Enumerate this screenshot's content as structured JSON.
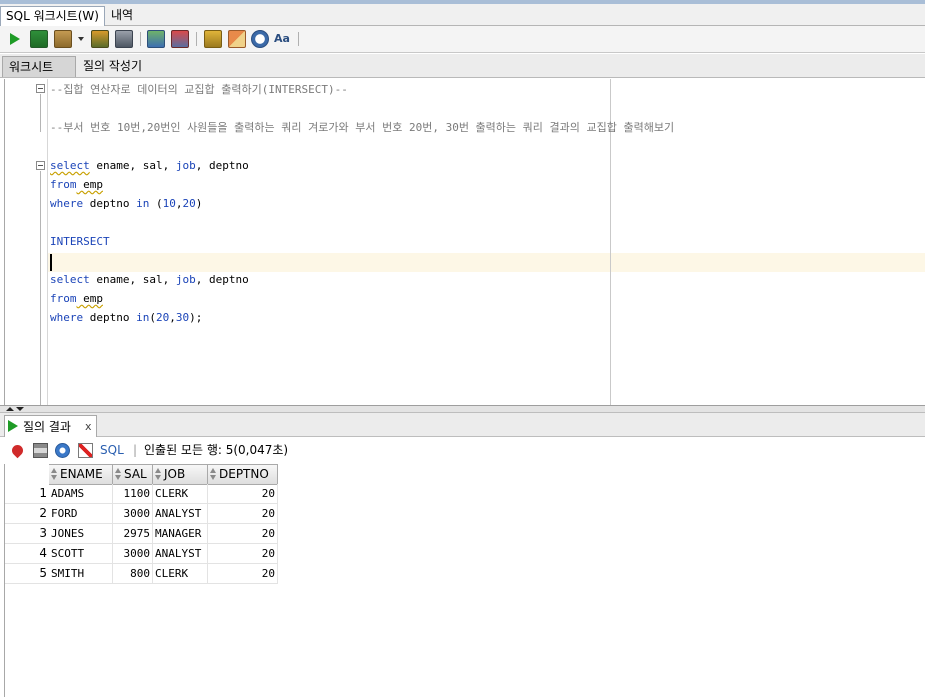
{
  "window": {
    "tabs": [
      {
        "label": "SQL 워크시트(W)"
      },
      {
        "label": "내역"
      }
    ]
  },
  "toolbar": {
    "buttons": [
      {
        "icon": "run-statement-icon"
      },
      {
        "icon": "run-script-icon"
      },
      {
        "icon": "multiple-sessions-icon"
      },
      {
        "icon": "explain-plan-icon"
      },
      {
        "icon": "autotrace-icon"
      },
      {
        "icon": "commit-icon"
      },
      {
        "icon": "rollback-icon"
      },
      {
        "icon": "sql-tuning-icon"
      },
      {
        "icon": "clear-icon"
      },
      {
        "icon": "history-icon"
      },
      {
        "icon": "format-icon"
      }
    ]
  },
  "subtabs": [
    {
      "label": "워크시트"
    },
    {
      "label": "질의 작성기"
    }
  ],
  "editor": {
    "lines": [
      {
        "text": "--집합 연산자로 데이터의 교집합 출력하기(INTERSECT)--"
      },
      {
        "text": ""
      },
      {
        "text": "--부서 번호 10번,20번인 사원들을 출력하는 쿼리 겨로가와 부서 번호 20번, 30번 출력하는 쿼리 결과의 교집합 출력해보기"
      },
      {
        "text": ""
      },
      {
        "kw1": "select",
        "rest1": " ename, sal, ",
        "kw2": "job",
        "rest2": ", deptno"
      },
      {
        "kw1": "from",
        "rest1": " emp"
      },
      {
        "kw1": "where",
        "rest1": " deptno ",
        "kw2": "in",
        "rest2": " (",
        "n1": "10",
        "c": ",",
        "n2": "20",
        "end": ")"
      },
      {
        "text": ""
      },
      {
        "kw1": "INTERSECT"
      },
      {
        "text": ""
      },
      {
        "kw1": "select",
        "rest1": " ename, sal, ",
        "kw2": "job",
        "rest2": ", deptno"
      },
      {
        "kw1": "from",
        "rest1": " emp"
      },
      {
        "kw1": "where",
        "rest1": " deptno ",
        "kw2": "in",
        "rest2": "(",
        "n1": "20",
        "c": ",",
        "n2": "30",
        "end": ");"
      }
    ]
  },
  "results": {
    "tab_label": "질의 결과",
    "tab_close": "x",
    "sql_label": "SQL",
    "separator": "|",
    "status": "인출된 모든 행: 5(0,047초)",
    "columns": [
      "ENAME",
      "SAL",
      "JOB",
      "DEPTNO"
    ],
    "rows": [
      {
        "num": "1",
        "ename": "ADAMS",
        "sal": "1100",
        "job": "CLERK",
        "deptno": "20"
      },
      {
        "num": "2",
        "ename": "FORD",
        "sal": "3000",
        "job": "ANALYST",
        "deptno": "20"
      },
      {
        "num": "3",
        "ename": "JONES",
        "sal": "2975",
        "job": "MANAGER",
        "deptno": "20"
      },
      {
        "num": "4",
        "ename": "SCOTT",
        "sal": "3000",
        "job": "ANALYST",
        "deptno": "20"
      },
      {
        "num": "5",
        "ename": "SMITH",
        "sal": "800",
        "job": "CLERK",
        "deptno": "20"
      }
    ]
  },
  "colors": {
    "keyword": "#1b44b8",
    "comment": "#7a7a7a",
    "current_line": "#fdf7e6",
    "run_green": "#1e9b26"
  }
}
